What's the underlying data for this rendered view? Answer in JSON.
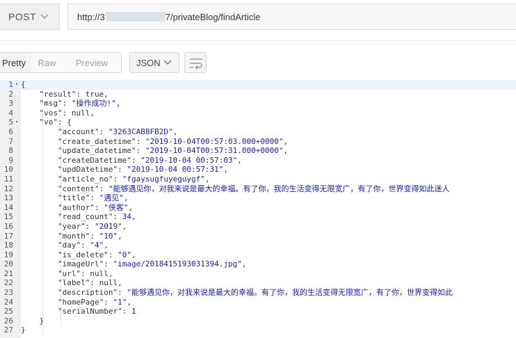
{
  "request": {
    "method": "POST",
    "url_prefix": "http://3",
    "url_suffix": "7/privateBlog/findArticle"
  },
  "response_toolbar": {
    "tabs": [
      "Pretty",
      "Raw",
      "Preview"
    ],
    "active_tab": "Pretty",
    "format": "JSON"
  },
  "editor": {
    "lines": [
      [
        {
          "t": "p",
          "v": "{"
        }
      ],
      [
        {
          "t": "p",
          "v": "    "
        },
        {
          "t": "k",
          "v": "\"result\""
        },
        {
          "t": "p",
          "v": ": "
        },
        {
          "t": "p",
          "v": "true"
        },
        {
          "t": "p",
          "v": ","
        }
      ],
      [
        {
          "t": "p",
          "v": "    "
        },
        {
          "t": "k",
          "v": "\"msg\""
        },
        {
          "t": "p",
          "v": ": "
        },
        {
          "t": "s",
          "v": "\"操作成功!\""
        },
        {
          "t": "p",
          "v": ","
        }
      ],
      [
        {
          "t": "p",
          "v": "    "
        },
        {
          "t": "k",
          "v": "\"vos\""
        },
        {
          "t": "p",
          "v": ": "
        },
        {
          "t": "p",
          "v": "null"
        },
        {
          "t": "p",
          "v": ","
        }
      ],
      [
        {
          "t": "p",
          "v": "    "
        },
        {
          "t": "k",
          "v": "\"vo\""
        },
        {
          "t": "p",
          "v": ": {"
        }
      ],
      [
        {
          "t": "p",
          "v": "        "
        },
        {
          "t": "k",
          "v": "\"account\""
        },
        {
          "t": "p",
          "v": ": "
        },
        {
          "t": "s",
          "v": "\"3263CAB8FB2D\""
        },
        {
          "t": "p",
          "v": ","
        }
      ],
      [
        {
          "t": "p",
          "v": "        "
        },
        {
          "t": "k",
          "v": "\"create_datetime\""
        },
        {
          "t": "p",
          "v": ": "
        },
        {
          "t": "s",
          "v": "\"2019-10-04T00:57:03.000+0000\""
        },
        {
          "t": "p",
          "v": ","
        }
      ],
      [
        {
          "t": "p",
          "v": "        "
        },
        {
          "t": "k",
          "v": "\"update_datetime\""
        },
        {
          "t": "p",
          "v": ": "
        },
        {
          "t": "s",
          "v": "\"2019-10-04T00:57:31.000+0000\""
        },
        {
          "t": "p",
          "v": ","
        }
      ],
      [
        {
          "t": "p",
          "v": "        "
        },
        {
          "t": "k",
          "v": "\"createDatetime\""
        },
        {
          "t": "p",
          "v": ": "
        },
        {
          "t": "s",
          "v": "\"2019-10-04 00:57:03\""
        },
        {
          "t": "p",
          "v": ","
        }
      ],
      [
        {
          "t": "p",
          "v": "        "
        },
        {
          "t": "k",
          "v": "\"updDatetime\""
        },
        {
          "t": "p",
          "v": ": "
        },
        {
          "t": "s",
          "v": "\"2019-10-04 00:57:31\""
        },
        {
          "t": "p",
          "v": ","
        }
      ],
      [
        {
          "t": "p",
          "v": "        "
        },
        {
          "t": "k",
          "v": "\"article_no\""
        },
        {
          "t": "p",
          "v": ": "
        },
        {
          "t": "s",
          "v": "\"fgaysugfuyeguygf\""
        },
        {
          "t": "p",
          "v": ","
        }
      ],
      [
        {
          "t": "p",
          "v": "        "
        },
        {
          "t": "k",
          "v": "\"content\""
        },
        {
          "t": "p",
          "v": ": "
        },
        {
          "t": "s",
          "v": "\"能够遇见你，对我来说是最大的幸福。有了你，我的生活变得无限宽广，有了你，世界变得如此迷人"
        }
      ],
      [
        {
          "t": "p",
          "v": "        "
        },
        {
          "t": "k",
          "v": "\"title\""
        },
        {
          "t": "p",
          "v": ": "
        },
        {
          "t": "s",
          "v": "\"遇见\""
        },
        {
          "t": "p",
          "v": ","
        }
      ],
      [
        {
          "t": "p",
          "v": "        "
        },
        {
          "t": "k",
          "v": "\"author\""
        },
        {
          "t": "p",
          "v": ": "
        },
        {
          "t": "s",
          "v": "\"侠客\""
        },
        {
          "t": "p",
          "v": ","
        }
      ],
      [
        {
          "t": "p",
          "v": "        "
        },
        {
          "t": "k",
          "v": "\"read_count\""
        },
        {
          "t": "p",
          "v": ": "
        },
        {
          "t": "n",
          "v": "34"
        },
        {
          "t": "p",
          "v": ","
        }
      ],
      [
        {
          "t": "p",
          "v": "        "
        },
        {
          "t": "k",
          "v": "\"year\""
        },
        {
          "t": "p",
          "v": ": "
        },
        {
          "t": "s",
          "v": "\"2019\""
        },
        {
          "t": "p",
          "v": ","
        }
      ],
      [
        {
          "t": "p",
          "v": "        "
        },
        {
          "t": "k",
          "v": "\"month\""
        },
        {
          "t": "p",
          "v": ": "
        },
        {
          "t": "s",
          "v": "\"10\""
        },
        {
          "t": "p",
          "v": ","
        }
      ],
      [
        {
          "t": "p",
          "v": "        "
        },
        {
          "t": "k",
          "v": "\"day\""
        },
        {
          "t": "p",
          "v": ": "
        },
        {
          "t": "s",
          "v": "\"4\""
        },
        {
          "t": "p",
          "v": ","
        }
      ],
      [
        {
          "t": "p",
          "v": "        "
        },
        {
          "t": "k",
          "v": "\"is_delete\""
        },
        {
          "t": "p",
          "v": ": "
        },
        {
          "t": "s",
          "v": "\"0\""
        },
        {
          "t": "p",
          "v": ","
        }
      ],
      [
        {
          "t": "p",
          "v": "        "
        },
        {
          "t": "k",
          "v": "\"imageUrl\""
        },
        {
          "t": "p",
          "v": ": "
        },
        {
          "t": "s",
          "v": "\"image/2018415193031394.jpg\""
        },
        {
          "t": "p",
          "v": ","
        }
      ],
      [
        {
          "t": "p",
          "v": "        "
        },
        {
          "t": "k",
          "v": "\"url\""
        },
        {
          "t": "p",
          "v": ": "
        },
        {
          "t": "p",
          "v": "null"
        },
        {
          "t": "p",
          "v": ","
        }
      ],
      [
        {
          "t": "p",
          "v": "        "
        },
        {
          "t": "k",
          "v": "\"label\""
        },
        {
          "t": "p",
          "v": ": "
        },
        {
          "t": "p",
          "v": "null"
        },
        {
          "t": "p",
          "v": ","
        }
      ],
      [
        {
          "t": "p",
          "v": "        "
        },
        {
          "t": "k",
          "v": "\"description\""
        },
        {
          "t": "p",
          "v": ": "
        },
        {
          "t": "s",
          "v": "\"能够遇见你，对我来说是最大的幸福。有了你，我的生活变得无限宽广，有了你，世界变得如此"
        }
      ],
      [
        {
          "t": "p",
          "v": "        "
        },
        {
          "t": "k",
          "v": "\"homePage\""
        },
        {
          "t": "p",
          "v": ": "
        },
        {
          "t": "s",
          "v": "\"1\""
        },
        {
          "t": "p",
          "v": ","
        }
      ],
      [
        {
          "t": "p",
          "v": "        "
        },
        {
          "t": "k",
          "v": "\"serialNumber\""
        },
        {
          "t": "p",
          "v": ": "
        },
        {
          "t": "n",
          "v": "1"
        }
      ],
      [
        {
          "t": "p",
          "v": "    }"
        }
      ],
      [
        {
          "t": "p",
          "v": "}"
        }
      ]
    ],
    "line_numbers": [
      "1",
      "2",
      "3",
      "4",
      "5",
      "6",
      "7",
      "8",
      "9",
      "10",
      "11",
      "12",
      "13",
      "14",
      "15",
      "16",
      "17",
      "18",
      "19",
      "20",
      "21",
      "22",
      "23",
      "24",
      "25",
      "26",
      "27"
    ],
    "fold_markers": {
      "1": "▾",
      "5": "▾"
    }
  },
  "colors": {
    "string": "#1a1aa6",
    "key": "#333333",
    "active_line": "#e8f2fe"
  }
}
